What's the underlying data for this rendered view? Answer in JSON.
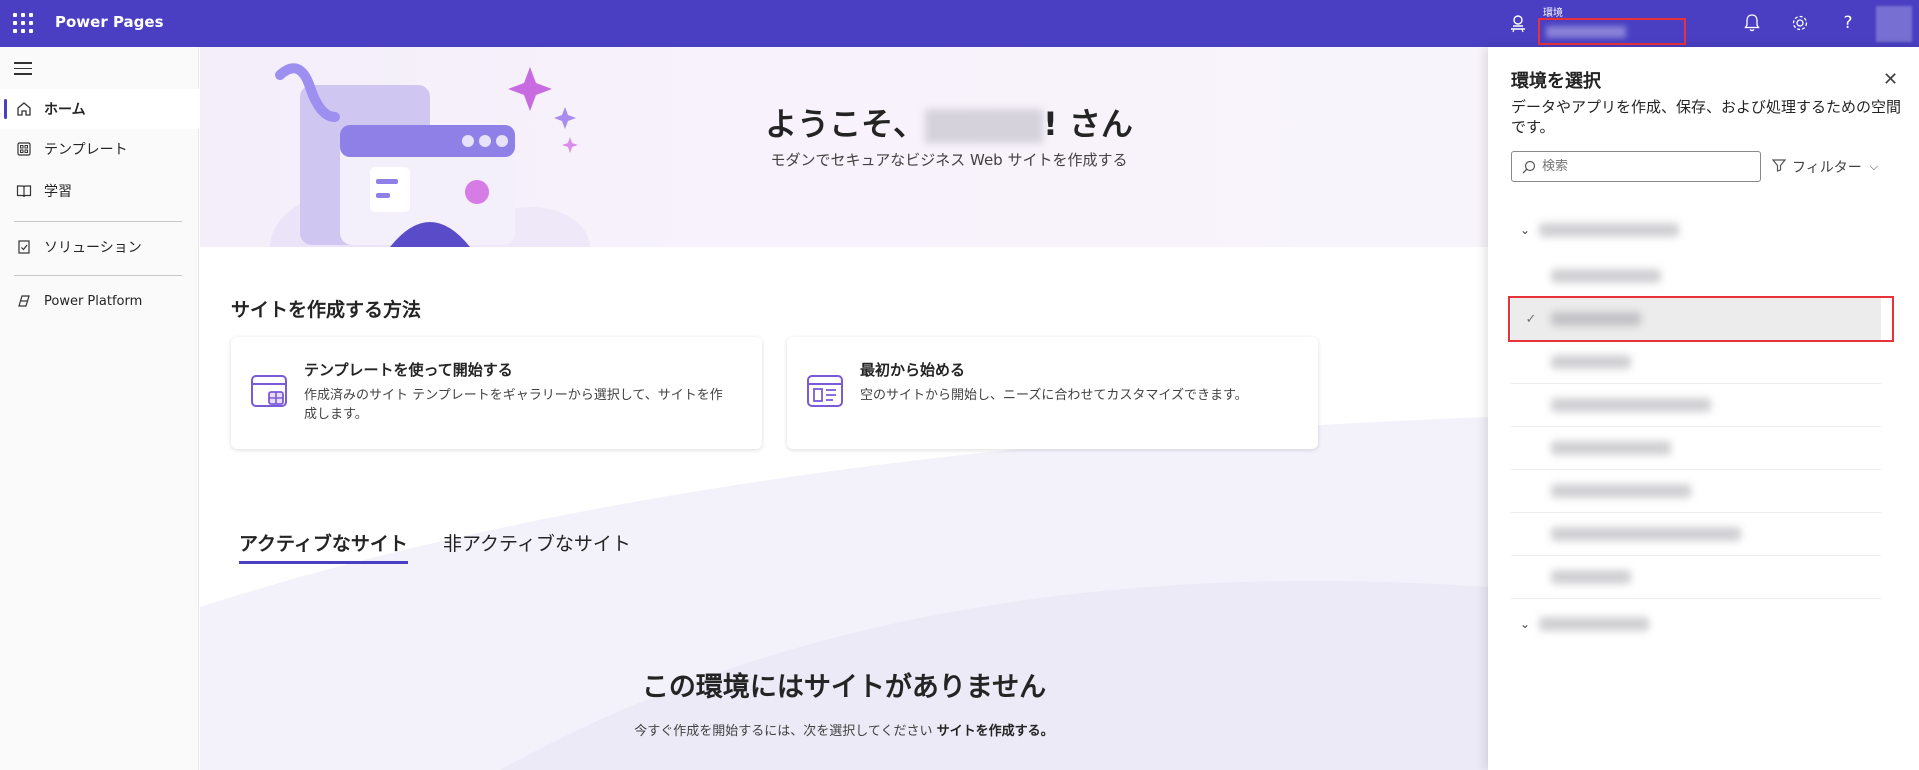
{
  "topbar": {
    "app_title": "Power Pages",
    "env_label": "環境",
    "icons": [
      "waffle-icon",
      "environment-icon",
      "bell-icon",
      "gear-icon",
      "help-icon"
    ],
    "help_glyph": "?",
    "bg_color": "#4a3fc2"
  },
  "sidebar": {
    "items": [
      {
        "label": "ホーム",
        "icon": "home-icon",
        "active": true
      },
      {
        "label": "テンプレート",
        "icon": "template-icon"
      },
      {
        "label": "学習",
        "icon": "book-icon"
      },
      {
        "label": "ソリューション",
        "icon": "solution-icon"
      },
      {
        "label": "Power Platform",
        "icon": "power-platform-icon"
      }
    ]
  },
  "hero": {
    "title_prefix": "ようこそ、",
    "title_suffix": "! さん",
    "subtitle": "モダンでセキュアなビジネス Web サイトを作成する"
  },
  "create": {
    "section_title": "サイトを作成する方法",
    "cards": [
      {
        "title": "テンプレートを使って開始する",
        "desc": "作成済みのサイト テンプレートをギャラリーから選択して、サイトを作成します。",
        "icon": "template-gallery-icon"
      },
      {
        "title": "最初から始める",
        "desc": "空のサイトから開始し、ニーズに合わせてカスタマイズできます。",
        "icon": "blank-site-icon"
      }
    ]
  },
  "tabs": {
    "active": "アクティブなサイト",
    "inactive": "非アクティブなサイト"
  },
  "empty": {
    "title": "この環境にはサイトがありません",
    "sub_prefix": "今すぐ作成を開始するには、次を選択してください",
    "sub_bold": "サイトを作成する。"
  },
  "panel": {
    "title": "環境を選択",
    "desc": "データやアプリを作成、保存、および処理するための空間です。",
    "search_placeholder": "検索",
    "filter_label": "フィルター",
    "accent": "#e8323a"
  }
}
